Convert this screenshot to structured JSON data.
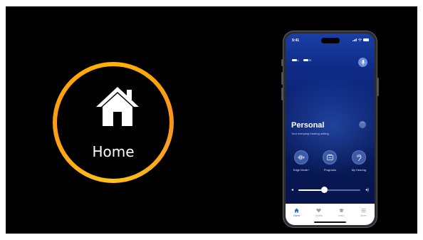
{
  "badge": {
    "label": "Home",
    "icon": "home-icon",
    "ring_color": "#ffb300"
  },
  "phone": {
    "status": {
      "time": "9:41"
    },
    "devices": [
      {
        "label": "L"
      },
      {
        "label": "R"
      }
    ],
    "program": {
      "title": "Personal",
      "subtitle": "Your everyday hearing setting"
    },
    "actions": [
      {
        "label": "Edge Mode+",
        "icon": "waveform-icon"
      },
      {
        "label": "Programs",
        "icon": "programs-icon"
      },
      {
        "label": "My Hearing",
        "icon": "ear-icon"
      }
    ],
    "volume": {
      "level": 0.42
    },
    "tabs": [
      {
        "label": "Home",
        "icon": "home-tab-icon",
        "active": true
      },
      {
        "label": "Health",
        "icon": "heart-icon",
        "active": false
      },
      {
        "label": "Learn",
        "icon": "learn-icon",
        "active": false
      },
      {
        "label": "More",
        "icon": "menu-icon",
        "active": false
      }
    ],
    "colors": {
      "accent": "#2563c9",
      "background": "#0b2170"
    }
  }
}
